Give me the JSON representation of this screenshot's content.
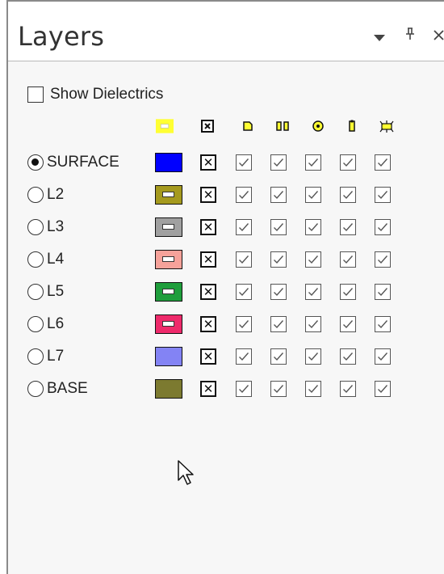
{
  "panel": {
    "title": "Layers",
    "icons": [
      "dropdown-arrow-icon",
      "pin-icon",
      "close-icon"
    ]
  },
  "show_dielectrics": {
    "label": "Show Dielectrics",
    "checked": false
  },
  "column_icons": [
    "layer-color-icon",
    "visibility-icon",
    "pad-icon",
    "via-icon",
    "target-icon",
    "pin-icon",
    "component-icon"
  ],
  "layers": [
    {
      "name": "SURFACE",
      "selected": true,
      "color": "#0000ff",
      "inner": null,
      "visible": true,
      "flags": [
        true,
        true,
        true,
        true,
        true
      ]
    },
    {
      "name": "L2",
      "selected": false,
      "color": "#a59a1e",
      "inner": "#ffffff",
      "visible": true,
      "flags": [
        true,
        true,
        true,
        true,
        true
      ]
    },
    {
      "name": "L3",
      "selected": false,
      "color": "#a0a0a0",
      "inner": "#ffffff",
      "visible": true,
      "flags": [
        true,
        true,
        true,
        true,
        true
      ]
    },
    {
      "name": "L4",
      "selected": false,
      "color": "#f6a29a",
      "inner": "#ffffff",
      "visible": true,
      "flags": [
        true,
        true,
        true,
        true,
        true
      ]
    },
    {
      "name": "L5",
      "selected": false,
      "color": "#1f9e3c",
      "inner": "#ffffff",
      "visible": true,
      "flags": [
        true,
        true,
        true,
        true,
        true
      ]
    },
    {
      "name": "L6",
      "selected": false,
      "color": "#ee2a6b",
      "inner": "#ffffff",
      "visible": true,
      "flags": [
        true,
        true,
        true,
        true,
        true
      ]
    },
    {
      "name": "L7",
      "selected": false,
      "color": "#8383f4",
      "inner": null,
      "visible": true,
      "flags": [
        true,
        true,
        true,
        true,
        true
      ]
    },
    {
      "name": "BASE",
      "selected": false,
      "color": "#7c7a30",
      "inner": null,
      "visible": true,
      "flags": [
        true,
        true,
        true,
        true,
        true
      ]
    }
  ]
}
